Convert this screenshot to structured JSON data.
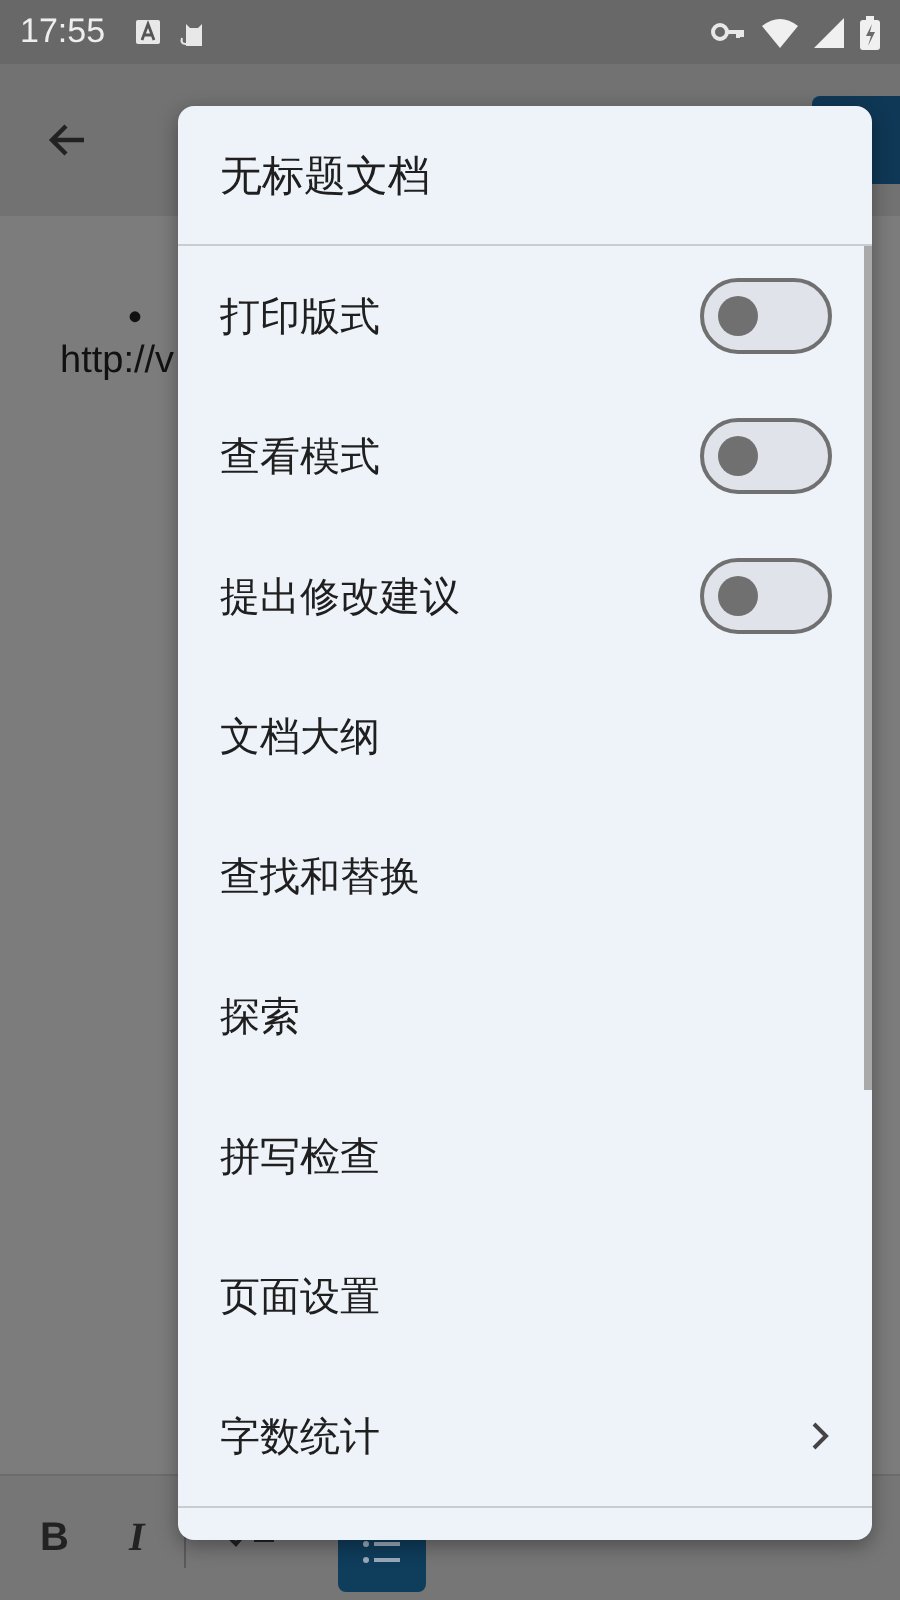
{
  "status_bar": {
    "time": "17:55"
  },
  "document": {
    "bullet": "•",
    "text": "http://v"
  },
  "menu": {
    "title": "无标题文档",
    "items": [
      {
        "kind": "toggle",
        "label": "打印版式",
        "on": false
      },
      {
        "kind": "toggle",
        "label": "查看模式",
        "on": false
      },
      {
        "kind": "toggle",
        "label": "提出修改建议",
        "on": false
      },
      {
        "kind": "plain",
        "label": "文档大纲"
      },
      {
        "kind": "plain",
        "label": "查找和替换"
      },
      {
        "kind": "plain",
        "label": "探索"
      },
      {
        "kind": "plain",
        "label": "拼写检查"
      },
      {
        "kind": "plain",
        "label": "页面设置"
      },
      {
        "kind": "submenu",
        "label": "字数统计"
      }
    ]
  },
  "format_toolbar": {
    "bold": "B",
    "italic": "I"
  }
}
